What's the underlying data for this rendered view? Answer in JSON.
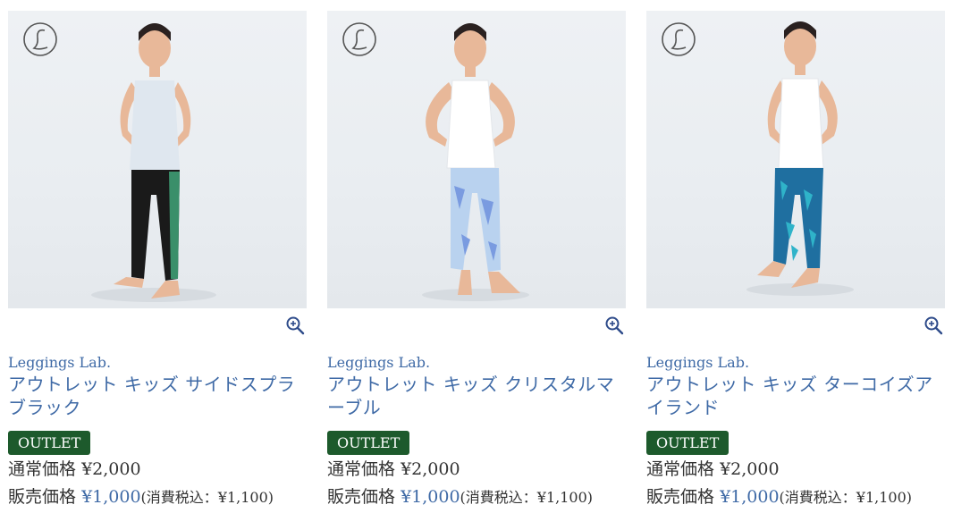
{
  "products": [
    {
      "brand": "Leggings Lab.",
      "title": "アウトレット キッズ サイドスプラ ブラック",
      "badge": "OUTLET",
      "regular_label": "通常価格",
      "regular_price": "¥2,000",
      "sale_label": "販売価格",
      "sale_price": "¥1,000",
      "tax_note": "(消費税込：¥1,100)",
      "leggings_color": "#1a1a1a",
      "accent_color": "#3a8f6a",
      "top_color": "#dfe7ef",
      "logo_icon": "leggings-lab-logo",
      "zoom_icon": "zoom-in-icon"
    },
    {
      "brand": "Leggings Lab.",
      "title": "アウトレット キッズ クリスタルマ ーブル",
      "badge": "OUTLET",
      "regular_label": "通常価格",
      "regular_price": "¥2,000",
      "sale_label": "販売価格",
      "sale_price": "¥1,000",
      "tax_note": "(消費税込：¥1,100)",
      "leggings_color": "#b9d2ef",
      "accent_color": "#7a9be0",
      "top_color": "#ffffff",
      "logo_icon": "leggings-lab-logo",
      "zoom_icon": "zoom-in-icon"
    },
    {
      "brand": "Leggings Lab.",
      "title": "アウトレット キッズ ターコイズア イランド",
      "badge": "OUTLET",
      "regular_label": "通常価格",
      "regular_price": "¥2,000",
      "sale_label": "販売価格",
      "sale_price": "¥1,000",
      "tax_note": "(消費税込：¥1,100)",
      "leggings_color": "#1f6fa0",
      "accent_color": "#2fb3c9",
      "top_color": "#ffffff",
      "logo_icon": "leggings-lab-logo",
      "zoom_icon": "zoom-in-icon"
    }
  ]
}
